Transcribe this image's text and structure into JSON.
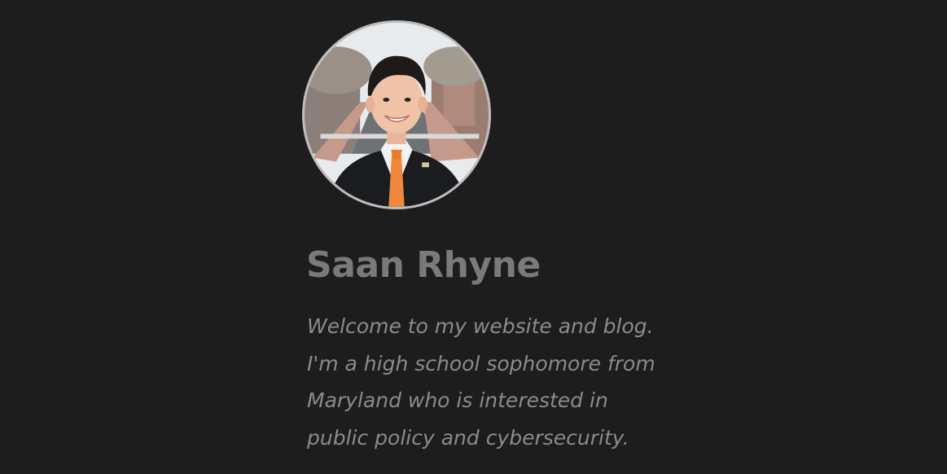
{
  "profile": {
    "name": "Saan Rhyne",
    "avatar_alt": "Portrait photo in a dark suit and orange tie",
    "bio_lines": [
      "Welcome to my website and blog.",
      "I'm a high school sophomore from",
      "Maryland who is interested in",
      "public policy and cybersecurity."
    ]
  },
  "colors": {
    "background": "#1d1d1d",
    "name_text": "#7a7a7a",
    "bio_text": "#8b8b8b",
    "avatar_border": "#bdbdbd"
  }
}
